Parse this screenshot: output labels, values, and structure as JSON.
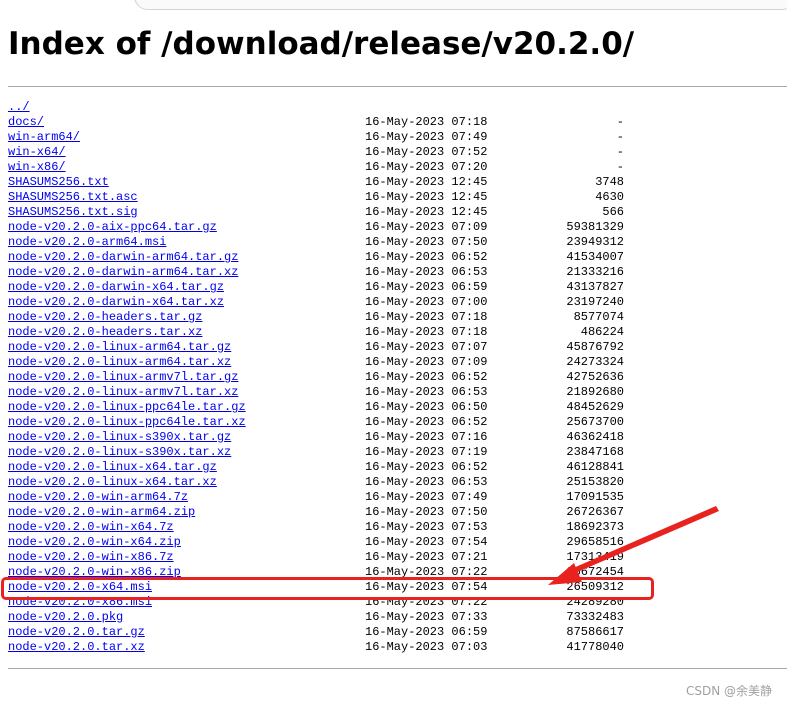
{
  "page": {
    "title": "Index of /download/release/v20.2.0/"
  },
  "parent_link": "../",
  "entries": [
    {
      "name": "docs/",
      "date": "16-May-2023 07:18",
      "size": "-"
    },
    {
      "name": "win-arm64/",
      "date": "16-May-2023 07:49",
      "size": "-"
    },
    {
      "name": "win-x64/",
      "date": "16-May-2023 07:52",
      "size": "-"
    },
    {
      "name": "win-x86/",
      "date": "16-May-2023 07:20",
      "size": "-"
    },
    {
      "name": "SHASUMS256.txt",
      "date": "16-May-2023 12:45",
      "size": "3748"
    },
    {
      "name": "SHASUMS256.txt.asc",
      "date": "16-May-2023 12:45",
      "size": "4630"
    },
    {
      "name": "SHASUMS256.txt.sig",
      "date": "16-May-2023 12:45",
      "size": "566"
    },
    {
      "name": "node-v20.2.0-aix-ppc64.tar.gz",
      "date": "16-May-2023 07:09",
      "size": "59381329"
    },
    {
      "name": "node-v20.2.0-arm64.msi",
      "date": "16-May-2023 07:50",
      "size": "23949312"
    },
    {
      "name": "node-v20.2.0-darwin-arm64.tar.gz",
      "date": "16-May-2023 06:52",
      "size": "41534007"
    },
    {
      "name": "node-v20.2.0-darwin-arm64.tar.xz",
      "date": "16-May-2023 06:53",
      "size": "21333216"
    },
    {
      "name": "node-v20.2.0-darwin-x64.tar.gz",
      "date": "16-May-2023 06:59",
      "size": "43137827"
    },
    {
      "name": "node-v20.2.0-darwin-x64.tar.xz",
      "date": "16-May-2023 07:00",
      "size": "23197240"
    },
    {
      "name": "node-v20.2.0-headers.tar.gz",
      "date": "16-May-2023 07:18",
      "size": "8577074"
    },
    {
      "name": "node-v20.2.0-headers.tar.xz",
      "date": "16-May-2023 07:18",
      "size": "486224"
    },
    {
      "name": "node-v20.2.0-linux-arm64.tar.gz",
      "date": "16-May-2023 07:07",
      "size": "45876792"
    },
    {
      "name": "node-v20.2.0-linux-arm64.tar.xz",
      "date": "16-May-2023 07:09",
      "size": "24273324"
    },
    {
      "name": "node-v20.2.0-linux-armv7l.tar.gz",
      "date": "16-May-2023 06:52",
      "size": "42752636"
    },
    {
      "name": "node-v20.2.0-linux-armv7l.tar.xz",
      "date": "16-May-2023 06:53",
      "size": "21892680"
    },
    {
      "name": "node-v20.2.0-linux-ppc64le.tar.gz",
      "date": "16-May-2023 06:50",
      "size": "48452629"
    },
    {
      "name": "node-v20.2.0-linux-ppc64le.tar.xz",
      "date": "16-May-2023 06:52",
      "size": "25673700"
    },
    {
      "name": "node-v20.2.0-linux-s390x.tar.gz",
      "date": "16-May-2023 07:16",
      "size": "46362418"
    },
    {
      "name": "node-v20.2.0-linux-s390x.tar.xz",
      "date": "16-May-2023 07:19",
      "size": "23847168"
    },
    {
      "name": "node-v20.2.0-linux-x64.tar.gz",
      "date": "16-May-2023 06:52",
      "size": "46128841"
    },
    {
      "name": "node-v20.2.0-linux-x64.tar.xz",
      "date": "16-May-2023 06:53",
      "size": "25153820"
    },
    {
      "name": "node-v20.2.0-win-arm64.7z",
      "date": "16-May-2023 07:49",
      "size": "17091535"
    },
    {
      "name": "node-v20.2.0-win-arm64.zip",
      "date": "16-May-2023 07:50",
      "size": "26726367"
    },
    {
      "name": "node-v20.2.0-win-x64.7z",
      "date": "16-May-2023 07:53",
      "size": "18692373"
    },
    {
      "name": "node-v20.2.0-win-x64.zip",
      "date": "16-May-2023 07:54",
      "size": "29658516"
    },
    {
      "name": "node-v20.2.0-win-x86.7z",
      "date": "16-May-2023 07:21",
      "size": "17313419"
    },
    {
      "name": "node-v20.2.0-win-x86.zip",
      "date": "16-May-2023 07:22",
      "size": "26672454"
    },
    {
      "name": "node-v20.2.0-x64.msi",
      "date": "16-May-2023 07:54",
      "size": "26509312"
    },
    {
      "name": "node-v20.2.0-x86.msi",
      "date": "16-May-2023 07:22",
      "size": "24289280"
    },
    {
      "name": "node-v20.2.0.pkg",
      "date": "16-May-2023 07:33",
      "size": "73332483"
    },
    {
      "name": "node-v20.2.0.tar.gz",
      "date": "16-May-2023 06:59",
      "size": "87586617"
    },
    {
      "name": "node-v20.2.0.tar.xz",
      "date": "16-May-2023 07:03",
      "size": "41778040"
    }
  ],
  "watermark": "CSDN @余美静",
  "colors": {
    "link": "#0000ee",
    "annotation": "#e8231f",
    "rule": "#a8a8a8"
  }
}
